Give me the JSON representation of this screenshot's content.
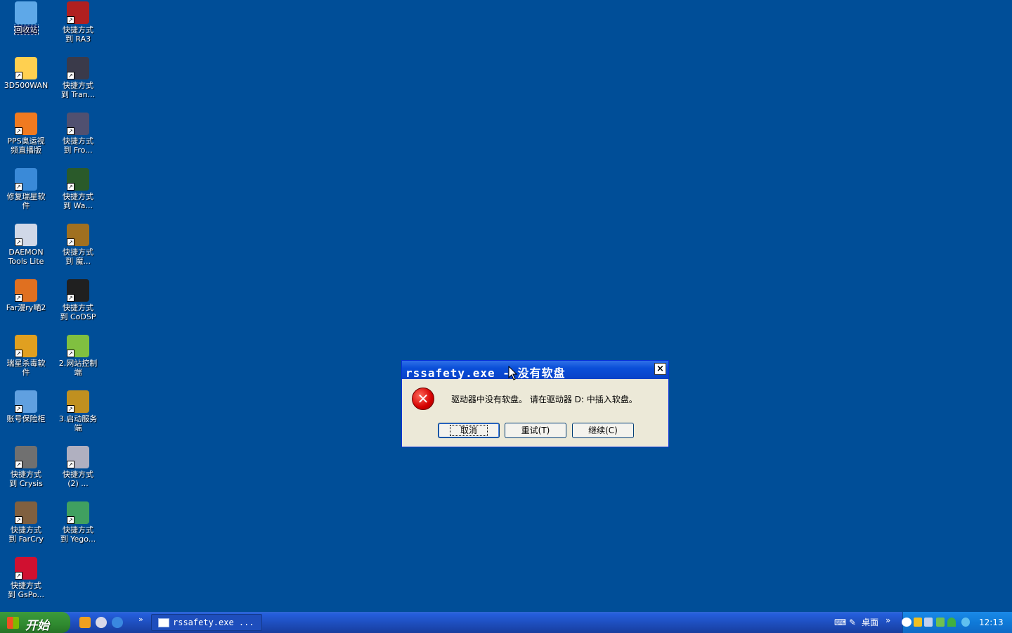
{
  "desktop": {
    "icons": [
      {
        "label": "回收站",
        "icon": "recycle-bin-icon",
        "color": "#5ea8e8"
      },
      {
        "label": "快捷方式\n到 RA3",
        "icon": "red-alert-3-icon",
        "color": "#b02020"
      },
      {
        "label": "3D500WAN",
        "icon": "3d500wan-icon",
        "color": "#ffd050"
      },
      {
        "label": "快捷方式\n到 Tran...",
        "icon": "transformers-icon",
        "color": "#3a3a4a"
      },
      {
        "label": "PPS奥运视\n频直播版",
        "icon": "pps-icon",
        "color": "#f07a20"
      },
      {
        "label": "快捷方式\n到 Fro...",
        "icon": "frozen-throne-icon",
        "color": "#505070"
      },
      {
        "label": "修复瑞星软\n件",
        "icon": "rising-repair-icon",
        "color": "#3a8ad8"
      },
      {
        "label": "快捷方式\n到 Wa...",
        "icon": "warcraft-icon",
        "color": "#2a5a2a"
      },
      {
        "label": "DAEMON\nTools Lite",
        "icon": "daemon-tools-icon",
        "color": "#d0d8e8"
      },
      {
        "label": "快捷方式\n到 魔...",
        "icon": "magic-game-icon",
        "color": "#a07020"
      },
      {
        "label": "Far漫ry嗮2",
        "icon": "farcry2-icon",
        "color": "#e07020"
      },
      {
        "label": "快捷方式\n到 CoDSP",
        "icon": "cod-icon",
        "color": "#202020"
      },
      {
        "label": "瑞星杀毒软\n件",
        "icon": "rising-antivirus-icon",
        "color": "#e0a020"
      },
      {
        "label": "2.网站控制\n端",
        "icon": "site-control-icon",
        "color": "#80c040"
      },
      {
        "label": "账号保险柜",
        "icon": "account-safe-icon",
        "color": "#60a0e0"
      },
      {
        "label": "3.启动服务\n端",
        "icon": "wow-server-icon",
        "color": "#c09020"
      },
      {
        "label": "快捷方式\n到 Crysis",
        "icon": "crysis-icon",
        "color": "#707070"
      },
      {
        "label": "快捷方式\n(2) ...",
        "icon": "shortcut-2-icon",
        "color": "#b0b0c0"
      },
      {
        "label": "快捷方式\n到 FarCry",
        "icon": "farcry-icon",
        "color": "#806040"
      },
      {
        "label": "快捷方式\n到 Yego...",
        "icon": "yego-icon",
        "color": "#40a060"
      },
      {
        "label": "快捷方式\n到 GsPo...",
        "icon": "gspo-icon",
        "color": "#d01030"
      }
    ]
  },
  "dialog": {
    "title": "rssafety.exe - 没有软盘",
    "message": "驱动器中没有软盘。 请在驱动器 D: 中插入软盘。",
    "close": "×",
    "error_glyph": "✕",
    "buttons": {
      "cancel": "取消",
      "retry": "重试(T)",
      "continue": "继续(C)"
    }
  },
  "taskbar": {
    "start": "开始",
    "chevron": "»",
    "task": "rssafety.exe ...",
    "desktop_label": "桌面",
    "desktop_chevron": "»",
    "clock": "12:13"
  }
}
